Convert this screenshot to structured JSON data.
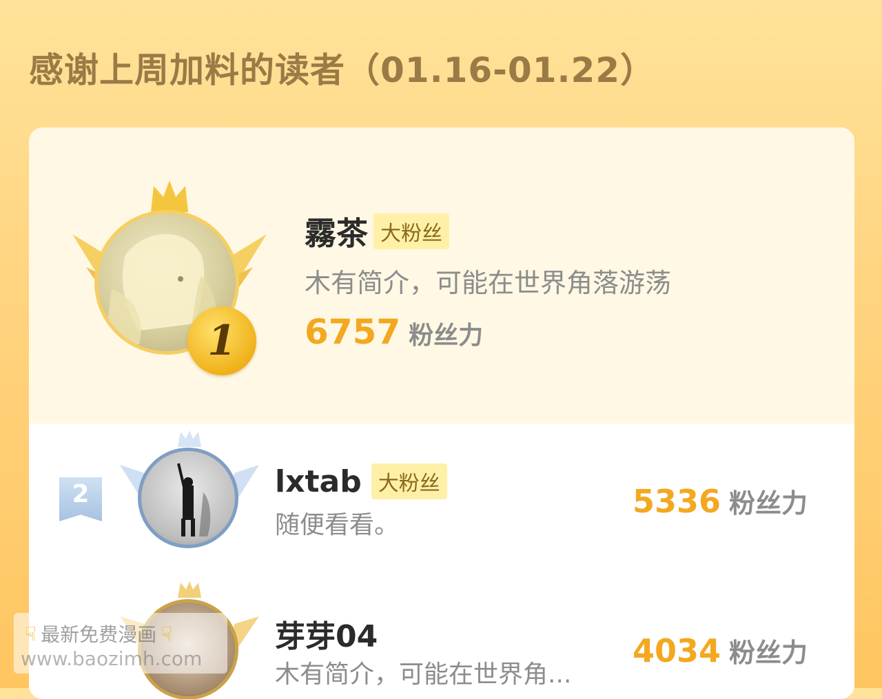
{
  "header": {
    "title": "感谢上周加料的读者（01.16-01.22）"
  },
  "top_fan": {
    "rank": "1",
    "name": "霧茶",
    "tag": "大粉丝",
    "bio": "木有简介，可能在世界角落游荡",
    "score": "6757",
    "score_label": "粉丝力"
  },
  "fans": [
    {
      "rank": "2",
      "name": "lxtab",
      "tag": "大粉丝",
      "bio": "随便看看。",
      "score": "5336",
      "score_label": "粉丝力"
    },
    {
      "rank": "3",
      "name": "芽芽04",
      "bio": "木有简介，可能在世界角...",
      "score": "4034",
      "score_label": "粉丝力"
    }
  ],
  "watermark": {
    "line1": "最新免费漫画",
    "line2": "www.baozimh.com"
  },
  "colors": {
    "accent": "#f3a820",
    "title": "#9a7a45",
    "gold": "#f0b21a",
    "silver": "#a7c2e2"
  }
}
